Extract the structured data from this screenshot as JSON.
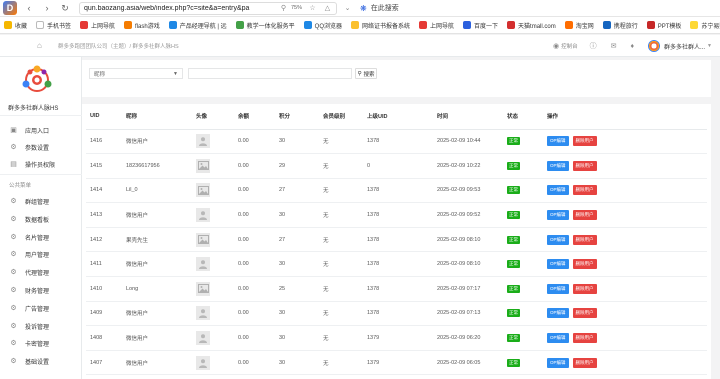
{
  "browser": {
    "url": "qun.baozang.asia/web/index.php?c=site&a=entry&pa",
    "zoom": "75%",
    "search_placeholder": "在此搜索"
  },
  "bookmarks": [
    {
      "label": "收藏",
      "color": "#f5b700"
    },
    {
      "label": "手机书签",
      "color": "#ffffff"
    },
    {
      "label": "上网导航",
      "color": "#e53935"
    },
    {
      "label": "flash游戏",
      "color": "#f57c00"
    },
    {
      "label": "产品经理导航 | 远",
      "color": "#1e88e5"
    },
    {
      "label": "教学一体化服务平",
      "color": "#43a047"
    },
    {
      "label": "QQ浏览器",
      "color": "#1e88e5"
    },
    {
      "label": "网络证书报备系统",
      "color": "#fbc02d"
    },
    {
      "label": "上网导航",
      "color": "#e53935"
    },
    {
      "label": "百度一下",
      "color": "#2b60de"
    },
    {
      "label": "天猫tmall.com",
      "color": "#d32f2f"
    },
    {
      "label": "淘宝网",
      "color": "#ff6d00"
    },
    {
      "label": "携程旅行",
      "color": "#1565c0"
    },
    {
      "label": "PPT模板",
      "color": "#c62828"
    },
    {
      "label": "苏宁易购",
      "color": "#fdd835"
    },
    {
      "label": "腾讯视频",
      "color": "#ff7043"
    }
  ],
  "header": {
    "breadcrumb": "群多多跑团团队公司（主题）/ 群多多社群人脉HS",
    "right_items": [
      {
        "label": "控制台",
        "icon": "dashboard-icon"
      },
      {
        "label": "",
        "icon": "help-icon"
      },
      {
        "label": "",
        "icon": "message-icon"
      },
      {
        "label": "",
        "icon": "bell-icon"
      }
    ],
    "user_name": "群多多社群人..."
  },
  "sidebar": {
    "site_name": "群多多社群人脉HS",
    "items_top": [
      {
        "label": "应用入口",
        "icon": "app-entry-icon"
      },
      {
        "label": "参数设置",
        "icon": "settings-icon"
      },
      {
        "label": "操作员权限",
        "icon": "permission-icon"
      }
    ],
    "section_title": "公共菜单",
    "items": [
      {
        "label": "群组管理",
        "icon": "group-icon"
      },
      {
        "label": "数据看板",
        "icon": "dashboard-icon"
      },
      {
        "label": "名片管理",
        "icon": "card-icon"
      },
      {
        "label": "用户管理",
        "icon": "user-icon"
      },
      {
        "label": "代理管理",
        "icon": "agent-icon"
      },
      {
        "label": "财务管理",
        "icon": "finance-icon"
      },
      {
        "label": "广告管理",
        "icon": "ad-icon"
      },
      {
        "label": "投诉管理",
        "icon": "complaint-icon"
      },
      {
        "label": "卡密管理",
        "icon": "key-icon"
      },
      {
        "label": "基础设置",
        "icon": "base-settings-icon"
      }
    ]
  },
  "filter": {
    "select_value": "昵称",
    "search_button": "搜索"
  },
  "table": {
    "columns": [
      "UID",
      "昵称",
      "头像",
      "余额",
      "积分",
      "会员级别",
      "上级UID",
      "时间",
      "状态",
      "操作"
    ],
    "status_label": "正常",
    "op_buttons": {
      "primary": "OP编辑",
      "danger": "删除用户"
    },
    "rows": [
      {
        "uid": "1416",
        "nick": "微信用户",
        "avatar": "person",
        "balance": "0.00",
        "points": "30",
        "level": "无",
        "parent": "1378",
        "time": "2025-02-09 10:44"
      },
      {
        "uid": "1415",
        "nick": "18236617956",
        "avatar": "image",
        "balance": "0.00",
        "points": "29",
        "level": "无",
        "parent": "0",
        "time": "2025-02-09 10:22"
      },
      {
        "uid": "1414",
        "nick": "Lil_0",
        "avatar": "image",
        "balance": "0.00",
        "points": "27",
        "level": "无",
        "parent": "1378",
        "time": "2025-02-09 09:53"
      },
      {
        "uid": "1413",
        "nick": "微信用户",
        "avatar": "person",
        "balance": "0.00",
        "points": "30",
        "level": "无",
        "parent": "1378",
        "time": "2025-02-09 09:52"
      },
      {
        "uid": "1412",
        "nick": "果壳先生",
        "avatar": "image",
        "balance": "0.00",
        "points": "27",
        "level": "无",
        "parent": "1378",
        "time": "2025-02-09 08:10"
      },
      {
        "uid": "1411",
        "nick": "微信用户",
        "avatar": "person",
        "balance": "0.00",
        "points": "30",
        "level": "无",
        "parent": "1378",
        "time": "2025-02-09 08:10"
      },
      {
        "uid": "1410",
        "nick": "Long",
        "avatar": "image",
        "balance": "0.00",
        "points": "25",
        "level": "无",
        "parent": "1378",
        "time": "2025-02-09 07:17"
      },
      {
        "uid": "1409",
        "nick": "微信用户",
        "avatar": "person",
        "balance": "0.00",
        "points": "30",
        "level": "无",
        "parent": "1378",
        "time": "2025-02-09 07:13"
      },
      {
        "uid": "1408",
        "nick": "微信用户",
        "avatar": "person",
        "balance": "0.00",
        "points": "30",
        "level": "无",
        "parent": "1379",
        "time": "2025-02-09 06:20"
      },
      {
        "uid": "1407",
        "nick": "微信用户",
        "avatar": "person",
        "balance": "0.00",
        "points": "30",
        "level": "无",
        "parent": "1379",
        "time": "2025-02-09 06:05"
      }
    ]
  }
}
